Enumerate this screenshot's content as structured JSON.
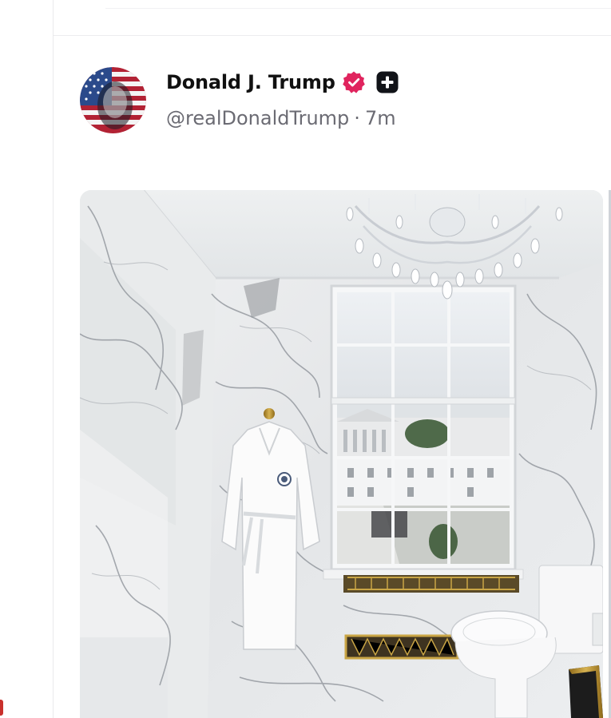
{
  "post": {
    "author": {
      "display_name": "Donald J. Trump",
      "handle": "@realDonaldTrump",
      "time_separator": "·",
      "time_ago": "7m",
      "verified_icon": "verified-badge-icon",
      "plus_icon": "plus-badge-icon",
      "verified_color": "#e0245e"
    },
    "media": {
      "type": "photo",
      "subject": "marble bathroom with window, chandelier, robe and toilet"
    }
  },
  "colors": {
    "text_primary": "#111111",
    "text_secondary": "#6b6b73",
    "divider": "#ececef"
  }
}
